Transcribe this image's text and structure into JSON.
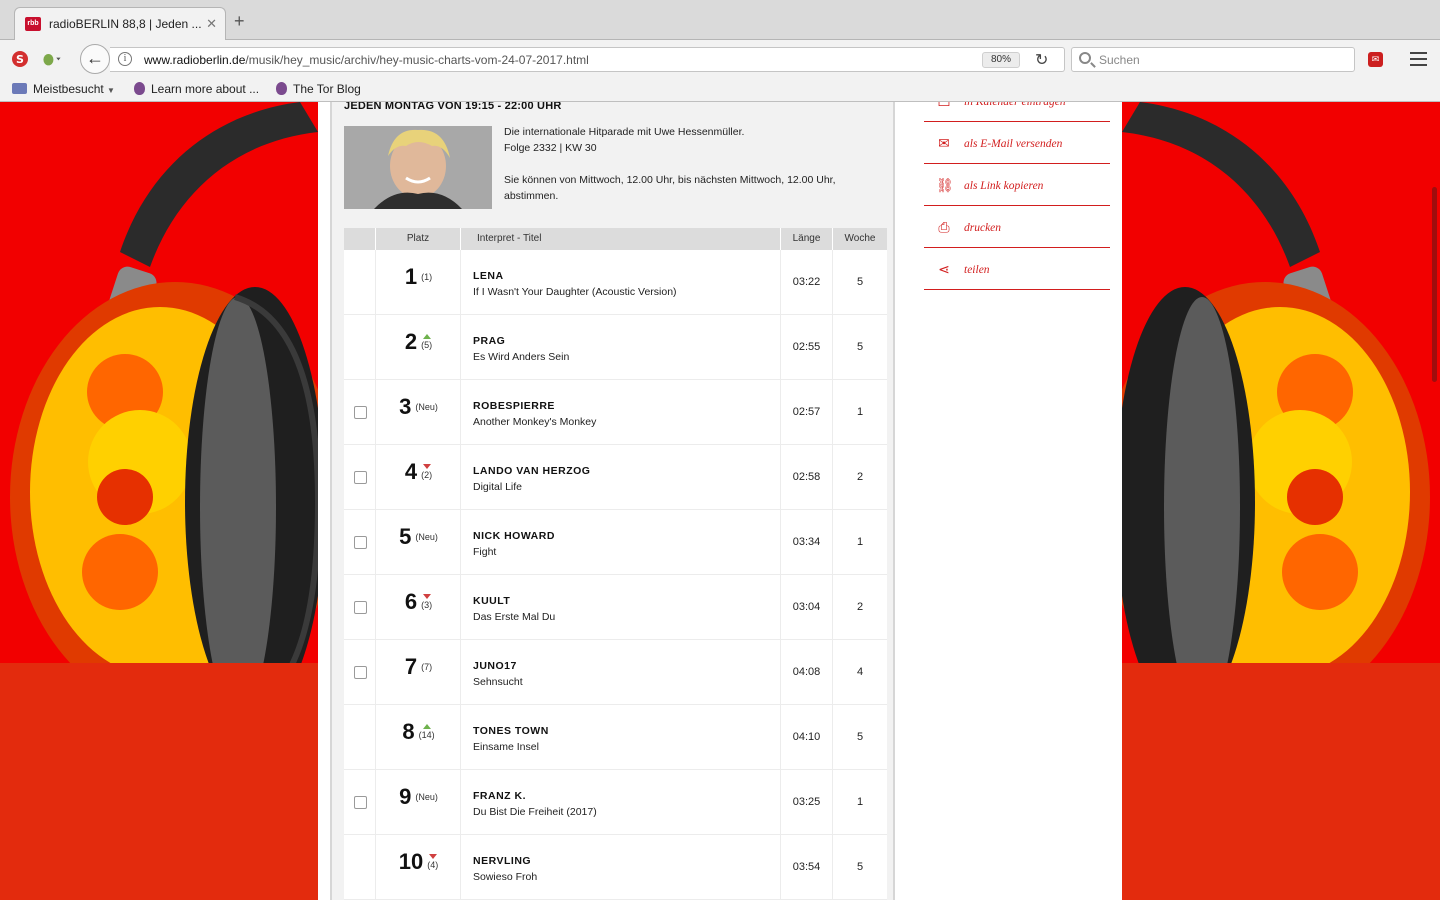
{
  "browser": {
    "tab_title": "radioBERLIN 88,8 | Jeden ...",
    "tab_favicon": "rbb",
    "url_domain": "www.radioberlin.de",
    "url_path": "/musik/hey_music/archiv/hey-music-charts-vom-24-07-2017.html",
    "zoom": "80%",
    "search_placeholder": "Suchen",
    "bookmarks": [
      "Meistbesucht",
      "Learn more about ...",
      "The Tor Blog"
    ]
  },
  "colors": {
    "page_red": "#f20000",
    "page_red_lower": "#e32b0d",
    "link_red": "#d21e1e",
    "up_green": "#6fb24d",
    "down_red": "#d04040"
  },
  "show": {
    "schedule": "JEDEN MONTAG VON 19:15 - 22:00 UHR",
    "desc_line1": "Die internationale Hitparade mit Uwe Hessenmüller.",
    "desc_line2": "Folge 2332 | KW 30",
    "desc_vote": "Sie können von Mittwoch, 12.00 Uhr, bis nächsten Mittwoch, 12.00 Uhr, abstimmen."
  },
  "chart": {
    "headers": {
      "place": "Platz",
      "title": "Interpret - Titel",
      "length": "Länge",
      "weeks": "Woche"
    },
    "rows": [
      {
        "rank": "1",
        "prev": "(1)",
        "trend": "none",
        "artist": "LENA",
        "title": "If I Wasn't Your Daughter (Acoustic Version)",
        "length": "03:22",
        "weeks": "5",
        "checkbox": false
      },
      {
        "rank": "2",
        "prev": "(5)",
        "trend": "up",
        "artist": "PRAG",
        "title": "Es Wird Anders Sein",
        "length": "02:55",
        "weeks": "5",
        "checkbox": false
      },
      {
        "rank": "3",
        "prev": "(Neu)",
        "trend": "none",
        "artist": "ROBESPIERRE",
        "title": "Another Monkey's Monkey",
        "length": "02:57",
        "weeks": "1",
        "checkbox": true
      },
      {
        "rank": "4",
        "prev": "(2)",
        "trend": "down",
        "artist": "LANDO VAN HERZOG",
        "title": "Digital Life",
        "length": "02:58",
        "weeks": "2",
        "checkbox": true
      },
      {
        "rank": "5",
        "prev": "(Neu)",
        "trend": "none",
        "artist": "NICK HOWARD",
        "title": "Fight",
        "length": "03:34",
        "weeks": "1",
        "checkbox": true
      },
      {
        "rank": "6",
        "prev": "(3)",
        "trend": "down",
        "artist": "KUULT",
        "title": "Das Erste Mal Du",
        "length": "03:04",
        "weeks": "2",
        "checkbox": true
      },
      {
        "rank": "7",
        "prev": "(7)",
        "trend": "none",
        "artist": "JUNO17",
        "title": "Sehnsucht",
        "length": "04:08",
        "weeks": "4",
        "checkbox": true
      },
      {
        "rank": "8",
        "prev": "(14)",
        "trend": "up",
        "artist": "TONES TOWN",
        "title": "Einsame Insel",
        "length": "04:10",
        "weeks": "5",
        "checkbox": false
      },
      {
        "rank": "9",
        "prev": "(Neu)",
        "trend": "none",
        "artist": "FRANZ K.",
        "title": "Du Bist Die Freiheit (2017)",
        "length": "03:25",
        "weeks": "1",
        "checkbox": true
      },
      {
        "rank": "10",
        "prev": "(4)",
        "trend": "down",
        "artist": "NERVLING",
        "title": "Sowieso Froh",
        "length": "03:54",
        "weeks": "5",
        "checkbox": false
      }
    ]
  },
  "share": [
    {
      "label": "in Kalender eintragen",
      "icon": "calendar-icon",
      "glyph": "▭"
    },
    {
      "label": "als E-Mail versenden",
      "icon": "mail-icon",
      "glyph": "✉"
    },
    {
      "label": "als Link kopieren",
      "icon": "link-icon",
      "glyph": "⛓"
    },
    {
      "label": "drucken",
      "icon": "print-icon",
      "glyph": "⎙"
    },
    {
      "label": "teilen",
      "icon": "share-icon",
      "glyph": "⋖"
    }
  ]
}
